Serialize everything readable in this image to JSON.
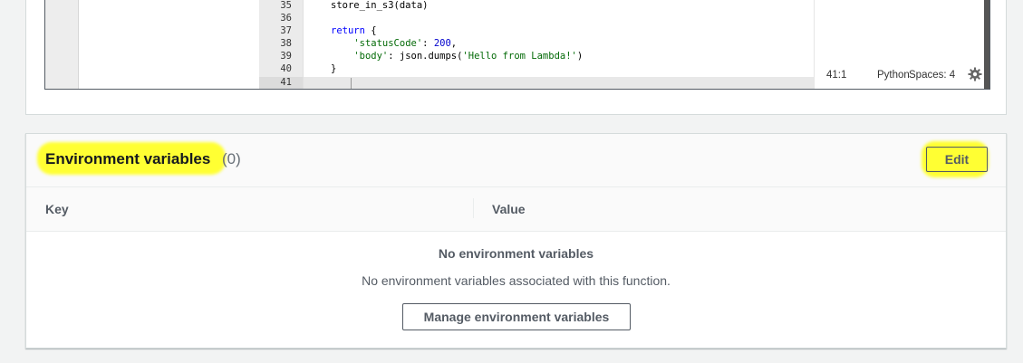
{
  "editor": {
    "line_numbers": [
      "35",
      "36",
      "37",
      "38",
      "39",
      "40",
      "41"
    ],
    "code_lines": {
      "l35": "store_in_s3(data)",
      "l37_kw": "return",
      "l37_rest": " {",
      "l38_key": "'statusCode'",
      "l38_sep": ": ",
      "l38_val": "200",
      "l38_end": ",",
      "l39_key": "'body'",
      "l39_mid": ": json.dumps(",
      "l39_str": "'Hello from Lambda!'",
      "l39_end": ")",
      "l40": "}"
    },
    "status": {
      "position": "41:1",
      "language": "Python",
      "indent": "Spaces: 4"
    },
    "icons": {
      "settings": "gear-icon"
    }
  },
  "env": {
    "title": "Environment variables",
    "count": "(0)",
    "edit_label": "Edit",
    "columns": [
      "Key",
      "Value"
    ],
    "empty_title": "No environment variables",
    "empty_description": "No environment variables associated with this function.",
    "manage_label": "Manage environment variables",
    "highlight_color": "#ffff33"
  }
}
